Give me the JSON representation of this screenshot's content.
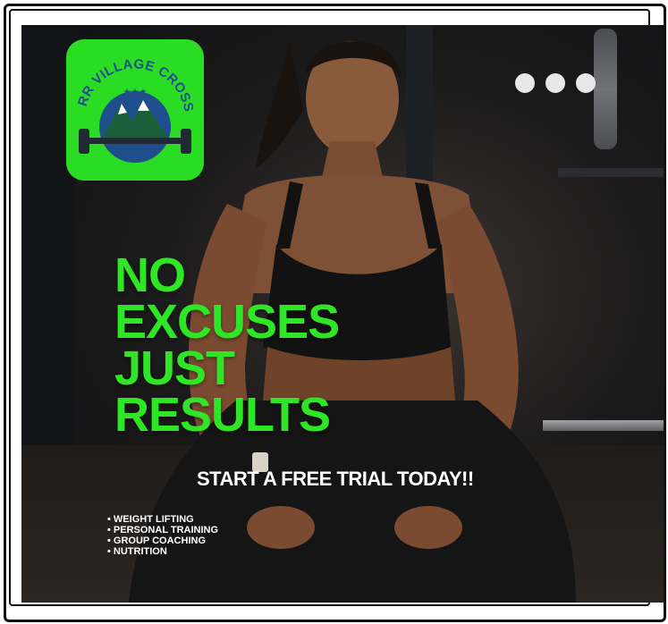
{
  "logo": {
    "text": "STARR VILLAGE CROSSFIT",
    "colors": {
      "badge": "#2bdc25",
      "emblem": "#1f4e8c",
      "mountains": "#1b5e3a"
    }
  },
  "pagination": {
    "dots": 3
  },
  "headline": [
    "NO",
    "EXCUSES",
    "JUST",
    "RESULTS"
  ],
  "cta": "START A FREE TRIAL TODAY!!",
  "services": [
    "WEIGHT LIFTING",
    "PERSONAL TRAINING",
    "GROUP COACHING",
    "NUTRITION"
  ],
  "colors": {
    "accent": "#2ee526",
    "text": "#ffffff",
    "background": "#161616"
  }
}
